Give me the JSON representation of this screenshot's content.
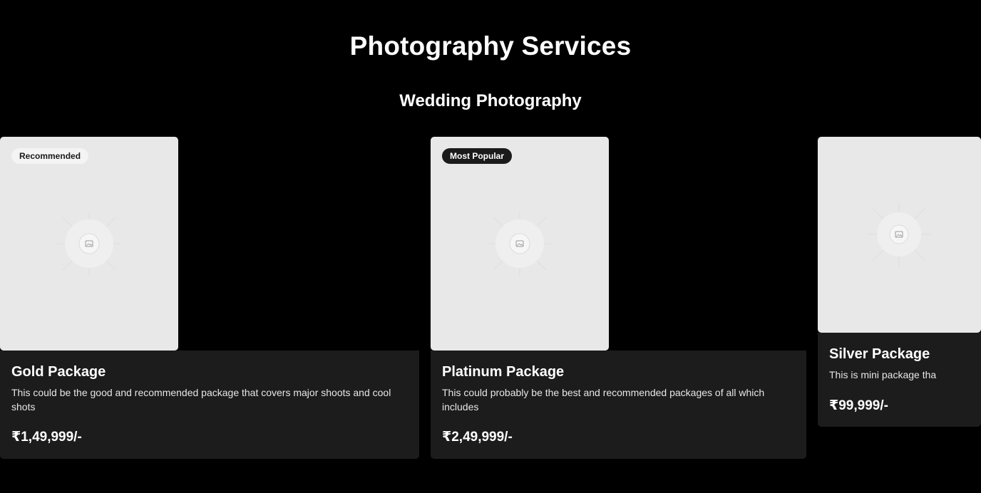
{
  "header": {
    "title": "Photography Services"
  },
  "section": {
    "title": "Wedding Photography"
  },
  "packages": [
    {
      "badge": "Recommended",
      "title": "Gold Package",
      "description": "This could be the good and recommended package that covers major shoots and cool shots",
      "price": "₹1,49,999/-",
      "image_icon": "image-placeholder-icon"
    },
    {
      "badge": "Most Popular",
      "title": "Platinum Package",
      "description": "This could probably be the best and recommended packages of all which includes",
      "price": "₹2,49,999/-",
      "image_icon": "image-placeholder-icon"
    },
    {
      "title": "Silver Package",
      "description": "This is mini package tha",
      "price": "₹99,999/-",
      "image_icon": "image-placeholder-icon"
    }
  ],
  "colors": {
    "background": "#000000",
    "card_body": "#1c1c1c",
    "image_placeholder": "#e8e8e8",
    "text": "#ffffff"
  }
}
